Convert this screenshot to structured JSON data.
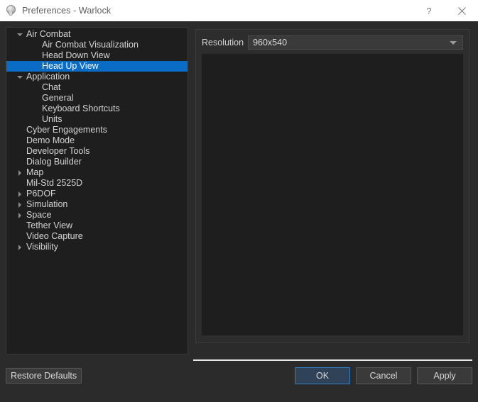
{
  "window": {
    "title": "Preferences - Warlock",
    "icon": "sphere-icon",
    "help_label": "?",
    "close_label": "✕"
  },
  "colors": {
    "selection_blue": "#0a6cc4",
    "focus_blue": "#2f7fc4",
    "panel_bg": "#1e1e1e",
    "window_bg": "#2b2b2b",
    "text": "#d4d4d4",
    "titlebar_bg": "#ffffff",
    "titlebar_text": "#5c5c5c"
  },
  "tree": {
    "items": [
      {
        "label": "Air Combat",
        "indent": 0,
        "arrow": "expanded",
        "selected": false
      },
      {
        "label": "Air Combat Visualization",
        "indent": 1,
        "arrow": "none",
        "selected": false
      },
      {
        "label": "Head Down View",
        "indent": 1,
        "arrow": "none",
        "selected": false
      },
      {
        "label": "Head Up View",
        "indent": 1,
        "arrow": "none",
        "selected": true
      },
      {
        "label": "Application",
        "indent": 0,
        "arrow": "expanded",
        "selected": false
      },
      {
        "label": "Chat",
        "indent": 1,
        "arrow": "none",
        "selected": false
      },
      {
        "label": "General",
        "indent": 1,
        "arrow": "none",
        "selected": false
      },
      {
        "label": "Keyboard Shortcuts",
        "indent": 1,
        "arrow": "none",
        "selected": false
      },
      {
        "label": "Units",
        "indent": 1,
        "arrow": "none",
        "selected": false
      },
      {
        "label": "Cyber Engagements",
        "indent": 0,
        "arrow": "none",
        "selected": false
      },
      {
        "label": "Demo Mode",
        "indent": 0,
        "arrow": "none",
        "selected": false
      },
      {
        "label": "Developer Tools",
        "indent": 0,
        "arrow": "none",
        "selected": false
      },
      {
        "label": "Dialog Builder",
        "indent": 0,
        "arrow": "none",
        "selected": false
      },
      {
        "label": "Map",
        "indent": 0,
        "arrow": "collapsed",
        "selected": false
      },
      {
        "label": "Mil-Std 2525D",
        "indent": 0,
        "arrow": "none",
        "selected": false
      },
      {
        "label": "P6DOF",
        "indent": 0,
        "arrow": "collapsed",
        "selected": false
      },
      {
        "label": "Simulation",
        "indent": 0,
        "arrow": "collapsed",
        "selected": false
      },
      {
        "label": "Space",
        "indent": 0,
        "arrow": "collapsed",
        "selected": false
      },
      {
        "label": "Tether View",
        "indent": 0,
        "arrow": "none",
        "selected": false
      },
      {
        "label": "Video Capture",
        "indent": 0,
        "arrow": "none",
        "selected": false
      },
      {
        "label": "Visibility",
        "indent": 0,
        "arrow": "collapsed",
        "selected": false
      }
    ]
  },
  "page": {
    "resolution": {
      "label": "Resolution",
      "value": "960x540"
    }
  },
  "buttons": {
    "restore_defaults": "Restore Defaults",
    "ok": "OK",
    "cancel": "Cancel",
    "apply": "Apply"
  }
}
